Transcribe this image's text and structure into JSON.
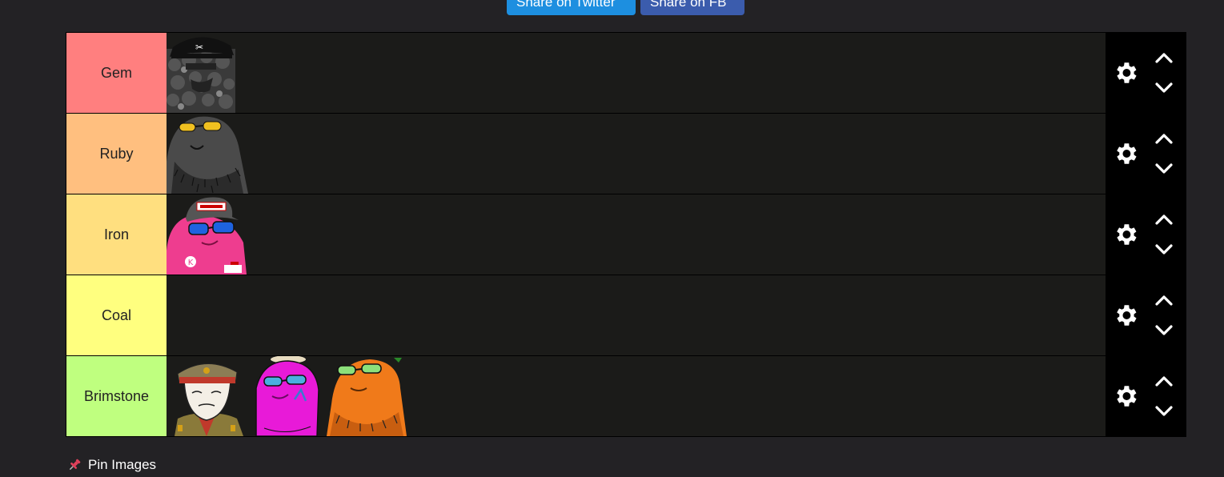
{
  "share": {
    "twitter_label": "Share on Twitter",
    "fb_label": "Share on FB"
  },
  "tiers": [
    {
      "label": "Gem",
      "color": "#ff7f7f"
    },
    {
      "label": "Ruby",
      "color": "#ffbf7f"
    },
    {
      "label": "Iron",
      "color": "#ffdf7f"
    },
    {
      "label": "Coal",
      "color": "#ffff7f"
    },
    {
      "label": "Brimstone",
      "color": "#bfff7f"
    }
  ],
  "pin": {
    "icon": "pushpin-icon",
    "label": "Pin Images"
  }
}
